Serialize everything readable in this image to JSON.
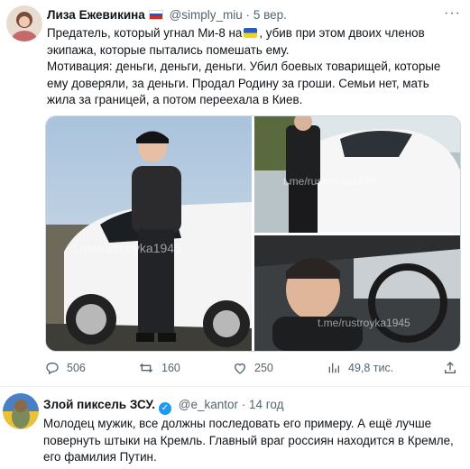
{
  "tweet1": {
    "author_name": "Лиза Ежевикина",
    "handle": "@simply_miu",
    "separator": "·",
    "time": "5 вер.",
    "more": "···",
    "line1_prefix": "Предатель, который угнал Ми-8 на",
    "line1_suffix": ", убив при этом двоих членов",
    "line2": "экипажа, которые пытались помешать ему.",
    "line3": "Мотивация: деньги, деньги, деньги. Убил боевых товарищей, которые",
    "line4": "ему доверяли, за деньги. Продал Родину за гроши. Семьи нет, мать",
    "line5": "жила за границей, а потом переехала в Киев.",
    "watermark": "t.me/rustroyka1945",
    "actions": {
      "replies": "506",
      "retweets": "160",
      "likes": "250",
      "views": "49,8 тис."
    }
  },
  "tweet2": {
    "author_name": "Злой пиксель ЗСУ.",
    "handle": "@e_kantor",
    "separator": "·",
    "time": "14 год",
    "line1": "Молодец мужик, все должны последовать его примеру. А ещё лучше",
    "line2": "повернуть штыки на Кремль. Главный враг россиян находится в Кремле,",
    "line3": "его фамилия Путин."
  },
  "icons": {
    "reply": "reply-icon",
    "retweet": "retweet-icon",
    "like": "heart-icon",
    "views": "views-icon",
    "share": "share-icon",
    "verified": "verified-badge-icon",
    "flag_ru": "russian-flag-icon",
    "flag_ua": "ukrainian-flag-icon"
  },
  "colors": {
    "text": "#0f1419",
    "secondary": "#536471",
    "verified": "#1d9bf0"
  }
}
